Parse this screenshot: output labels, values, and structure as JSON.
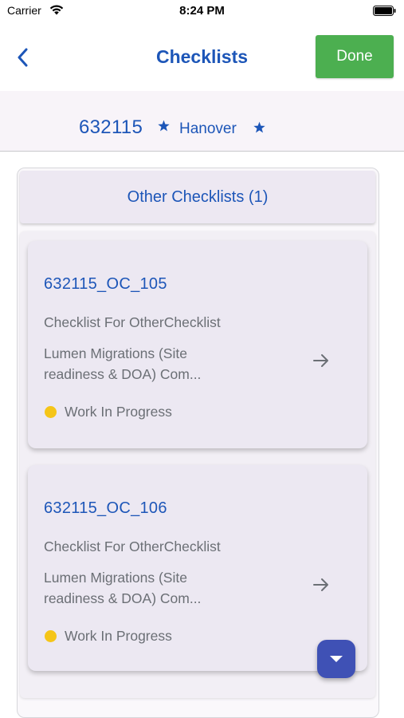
{
  "status_bar": {
    "carrier": "Carrier",
    "time": "8:24 PM"
  },
  "nav": {
    "title": "Checklists",
    "done_label": "Done",
    "back_icon": "chevron-left-icon",
    "accent_color": "#1d56b8",
    "done_color": "#4caf50"
  },
  "site": {
    "id": "632115",
    "name": "Hanover",
    "star_icon": "star-icon"
  },
  "group": {
    "header": "Other Checklists (1)"
  },
  "checklists": [
    {
      "title": "632115_OC_105",
      "subtitle": "Checklist For OtherChecklist",
      "desc_line1": "Lumen Migrations (Site",
      "desc_line2": "readiness & DOA) Com...",
      "status": "Work In Progress",
      "status_color": "#f5c518",
      "arrow_icon": "arrow-right-icon"
    },
    {
      "title": "632115_OC_106",
      "subtitle": "Checklist For OtherChecklist",
      "desc_line1": "Lumen Migrations (Site",
      "desc_line2": "readiness & DOA) Com...",
      "status": "Work In Progress",
      "status_color": "#f5c518",
      "arrow_icon": "arrow-right-icon"
    }
  ],
  "fab": {
    "icon": "caret-down-icon",
    "color": "#3f51b5"
  }
}
